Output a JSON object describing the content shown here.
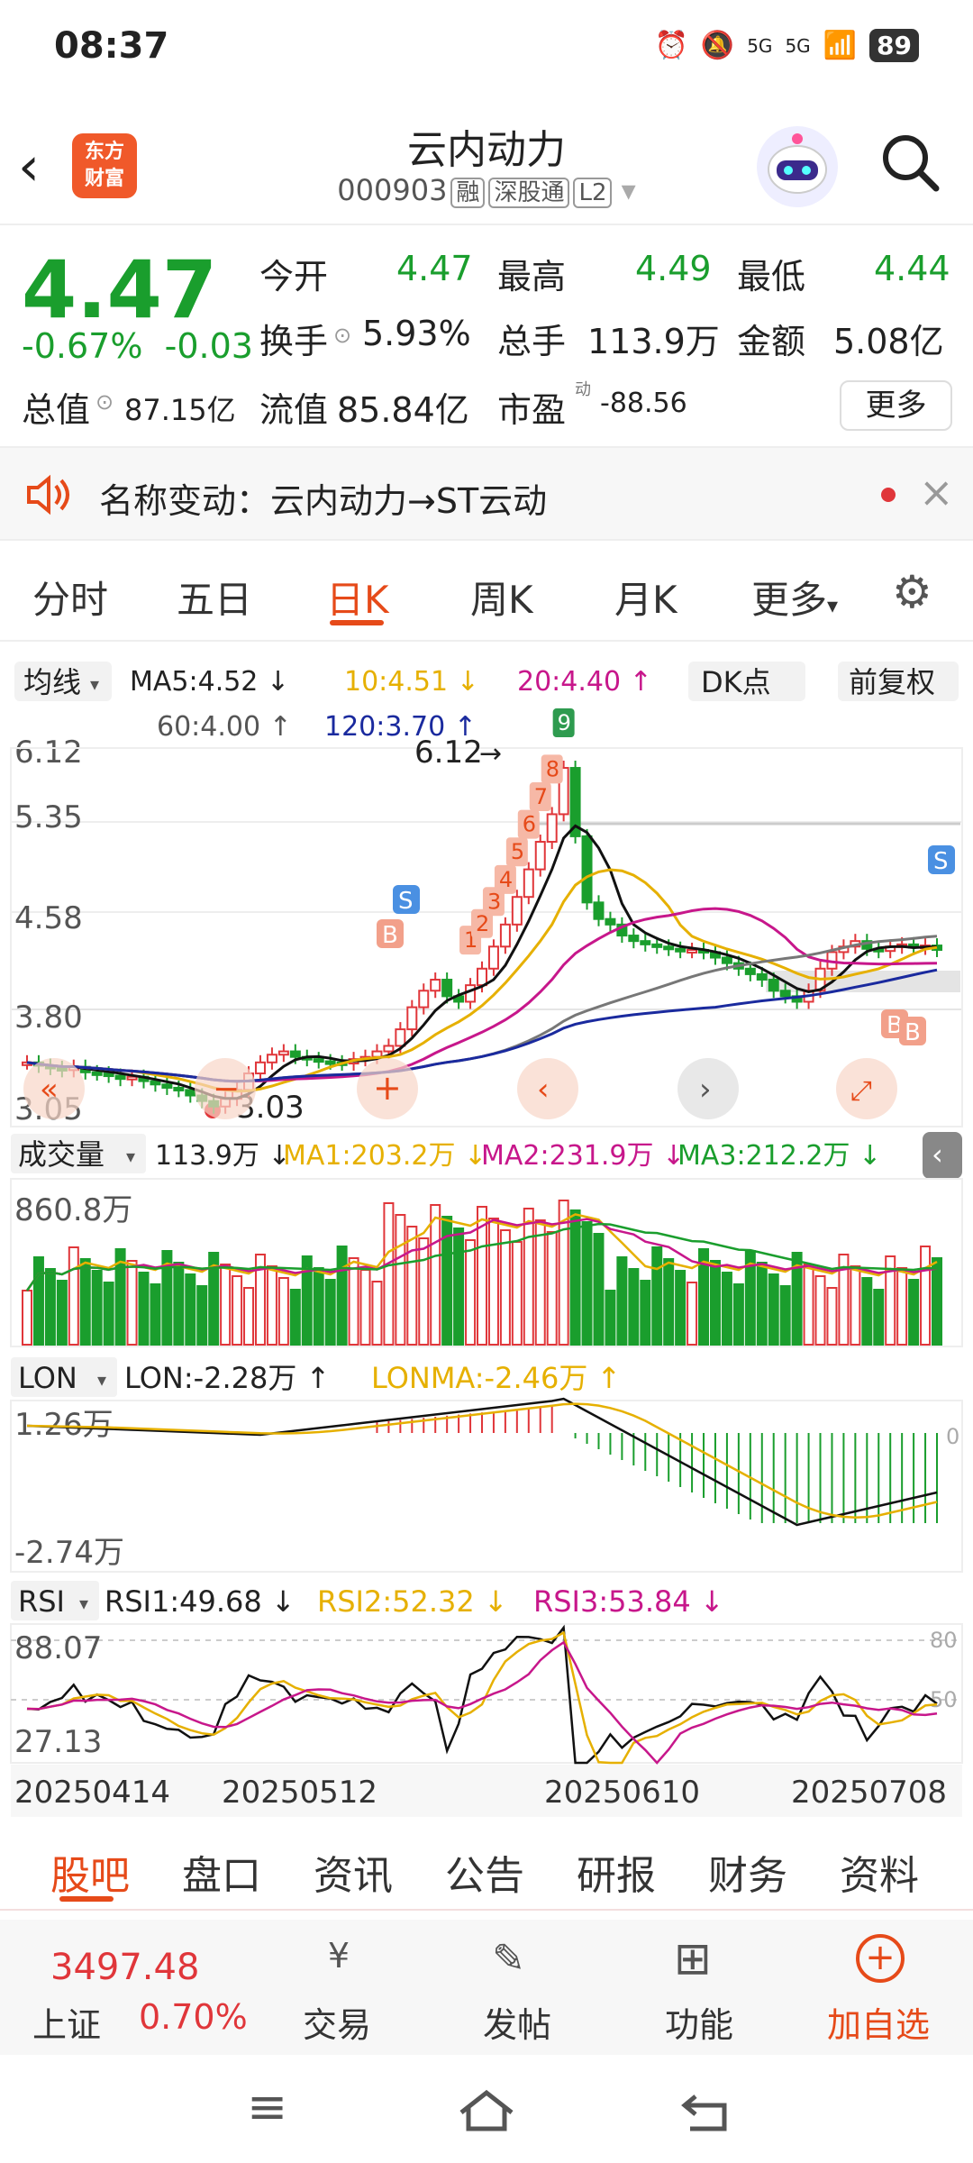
{
  "status": {
    "time": "08:37",
    "battery": "89",
    "signal1": "5G",
    "signal2": "5G"
  },
  "header": {
    "name": "云内动力",
    "code": "000903",
    "tags": [
      "融",
      "深股通",
      "L2"
    ],
    "logo": "东方\n财富"
  },
  "quote": {
    "price": "4.47",
    "pct": "-0.67%",
    "chg": "-0.03",
    "open_label": "今开",
    "open": "4.47",
    "high_label": "最高",
    "high": "4.49",
    "low_label": "最低",
    "low": "4.44",
    "turnover_label": "换手",
    "turnover": "5.93%",
    "volume_label": "总手",
    "volume": "113.9万",
    "amount_label": "金额",
    "amount": "5.08亿",
    "mcap_label": "总值",
    "mcap": "87.15亿",
    "float_label": "流值",
    "float": "85.84亿",
    "pe_label": "市盈",
    "pe_sup": "动",
    "pe": "-88.56",
    "more": "更多"
  },
  "notice": {
    "text": "名称变动：云内动力→ST云动"
  },
  "tabs": [
    "分时",
    "五日",
    "日K",
    "周K",
    "月K",
    "更多"
  ],
  "active_tab": "日K",
  "kline": {
    "ma_selector": "均线",
    "ma5": "MA5:4.52 ↓",
    "ma10": "10:4.51 ↓",
    "ma20": "20:4.40 ↑",
    "ma60": "60:4.00 ↑",
    "ma120": "120:3.70 ↑",
    "dk": "DK点",
    "fq": "前复权",
    "y_labels": [
      "6.12",
      "5.35",
      "4.58",
      "3.80",
      "3.05"
    ],
    "max_label": "6.12",
    "min_label": "3.03",
    "nine_turn": [
      "1",
      "2",
      "3",
      "4",
      "5",
      "6",
      "7",
      "8",
      "9"
    ]
  },
  "volume": {
    "selector": "成交量",
    "val": "113.9万 ↓",
    "ma1": "MA1:203.2万 ↓",
    "ma2": "MA2:231.9万 ↓",
    "ma3": "MA3:212.2万 ↓",
    "y_max": "860.8万"
  },
  "lon": {
    "selector": "LON",
    "val": "LON:-2.28万 ↑",
    "ma": "LONMA:-2.46万 ↑",
    "y_top": "1.26万",
    "y_bottom": "-2.74万",
    "zero": "0"
  },
  "rsi": {
    "selector": "RSI",
    "rsi1": "RSI1:49.68 ↓",
    "rsi2": "RSI2:52.32 ↓",
    "rsi3": "RSI3:53.84 ↓",
    "y_top": "88.07",
    "y_bottom": "27.13",
    "l80": "80",
    "l50": "50"
  },
  "dates": [
    "20250414",
    "20250512",
    "20250610",
    "20250708"
  ],
  "bottom_tabs": [
    "股吧",
    "盘口",
    "资讯",
    "公告",
    "研报",
    "财务",
    "资料"
  ],
  "toolbar": {
    "index_value": "3497.48",
    "index_name": "上证",
    "index_pct": "0.70%",
    "trade": "交易",
    "post": "发帖",
    "func": "功能",
    "add": "加自选"
  },
  "colors": {
    "up": "#e0363a",
    "down": "#1a9e2d",
    "accent": "#e64a19"
  }
}
